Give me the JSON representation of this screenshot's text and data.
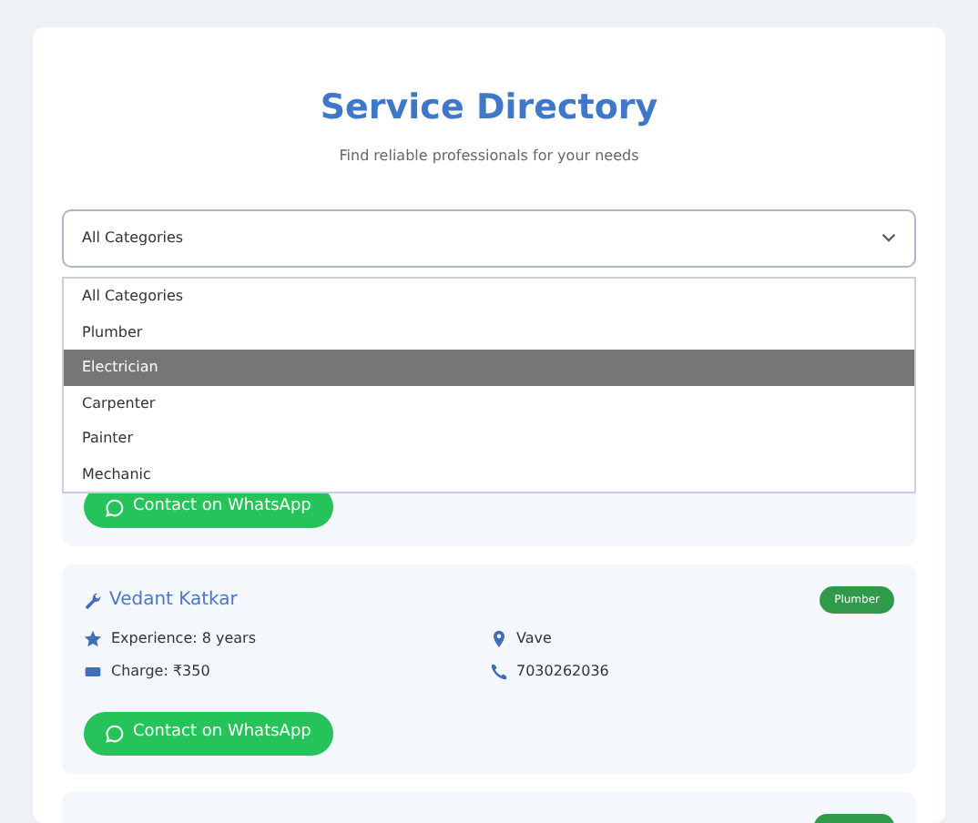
{
  "header": {
    "title": "Service Directory",
    "subtitle": "Find reliable professionals for your needs"
  },
  "category_select": {
    "value": "All Categories",
    "expanded": true,
    "options": [
      {
        "label": "All Categories",
        "highlighted": false
      },
      {
        "label": "Plumber",
        "highlighted": false
      },
      {
        "label": "Electrician",
        "highlighted": true
      },
      {
        "label": "Carpenter",
        "highlighted": false
      },
      {
        "label": "Painter",
        "highlighted": false
      },
      {
        "label": "Mechanic",
        "highlighted": false
      }
    ]
  },
  "providers": [
    {
      "contact_button": "Contact on WhatsApp"
    },
    {
      "name": "Vedant Katkar",
      "category": "Plumber",
      "experience": "Experience: 8 years",
      "location": "Vave",
      "charge": "Charge: ₹350",
      "phone": "7030262036",
      "contact_button": "Contact on WhatsApp"
    },
    {
      "kind": "partial"
    }
  ]
}
